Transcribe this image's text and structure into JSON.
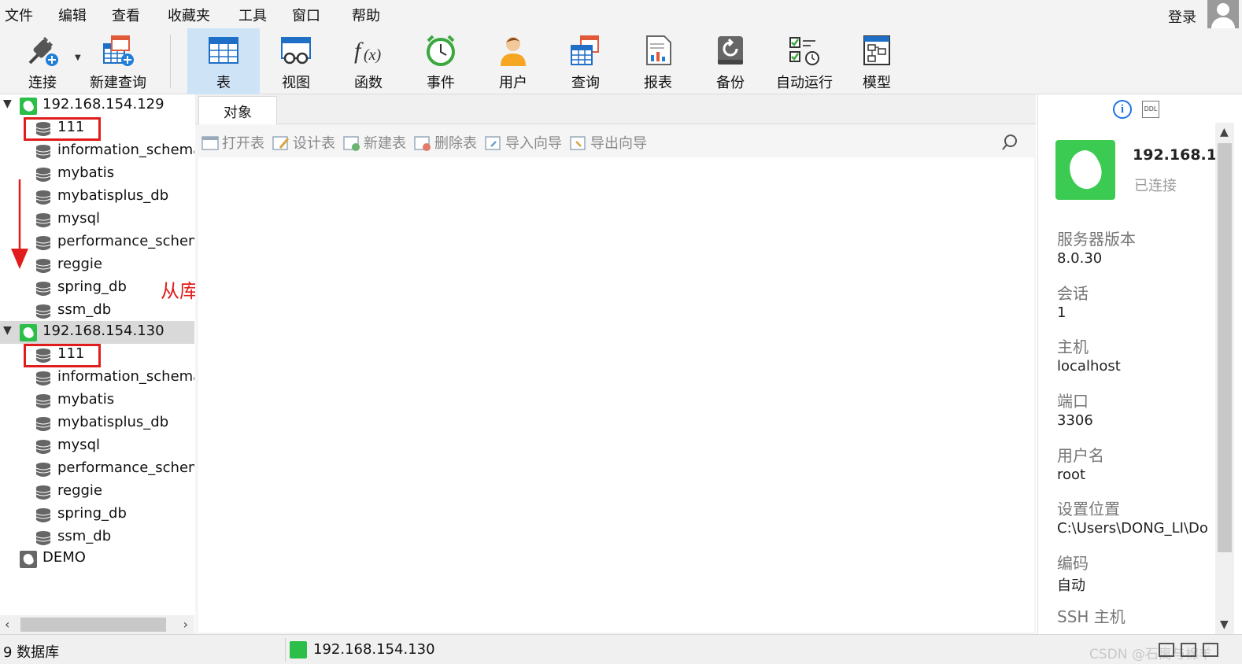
{
  "menu": {
    "file": "文件",
    "edit": "编辑",
    "view": "查看",
    "favorites": "收藏夹",
    "tools": "工具",
    "window": "窗口",
    "help": "帮助",
    "login": "登录"
  },
  "toolbar": {
    "connect": "连接",
    "new_query": "新建查询",
    "table": "表",
    "view": "视图",
    "function": "函数",
    "event": "事件",
    "user": "用户",
    "query": "查询",
    "report": "报表",
    "backup": "备份",
    "automation": "自动运行",
    "model": "模型"
  },
  "tree": {
    "connections": [
      {
        "name": "192.168.154.129",
        "databases": [
          "111",
          "information_schema",
          "mybatis",
          "mybatisplus_db",
          "mysql",
          "performance_schem",
          "reggie",
          "spring_db",
          "ssm_db"
        ]
      },
      {
        "name": "192.168.154.130",
        "databases": [
          "111",
          "information_schema",
          "mybatis",
          "mybatisplus_db",
          "mysql",
          "performance_schem",
          "reggie",
          "spring_db",
          "ssm_db"
        ]
      },
      {
        "name": "DEMO",
        "databases": []
      }
    ]
  },
  "annotation": {
    "note": "从库与主库保持同步",
    "color": "#e11c1c"
  },
  "center": {
    "tab_objects": "对象",
    "actions": {
      "open_table": "打开表",
      "design_table": "设计表",
      "new_table": "新建表",
      "delete_table": "删除表",
      "import_wizard": "导入向导",
      "export_wizard": "导出向导"
    }
  },
  "info": {
    "connection_name": "192.168.1",
    "status": "已连接",
    "server_version_label": "服务器版本",
    "server_version": "8.0.30",
    "session_label": "会话",
    "session": "1",
    "host_label": "主机",
    "host": "localhost",
    "port_label": "端口",
    "port": "3306",
    "username_label": "用户名",
    "username": "root",
    "settings_location_label": "设置位置",
    "settings_location": "C:\\Users\\DONG_LI\\Do",
    "encoding_label": "编码",
    "encoding": "自动",
    "ssh_host_label": "SSH 主机"
  },
  "status": {
    "db_count": "9 数据库",
    "connection": "192.168.154.130",
    "watermark": "CSDN @石离与棉羊"
  },
  "colors": {
    "mysql_green": "#2bbf4a",
    "active_tab": "#cfe3f6",
    "highlight_red": "#e11c1c"
  }
}
